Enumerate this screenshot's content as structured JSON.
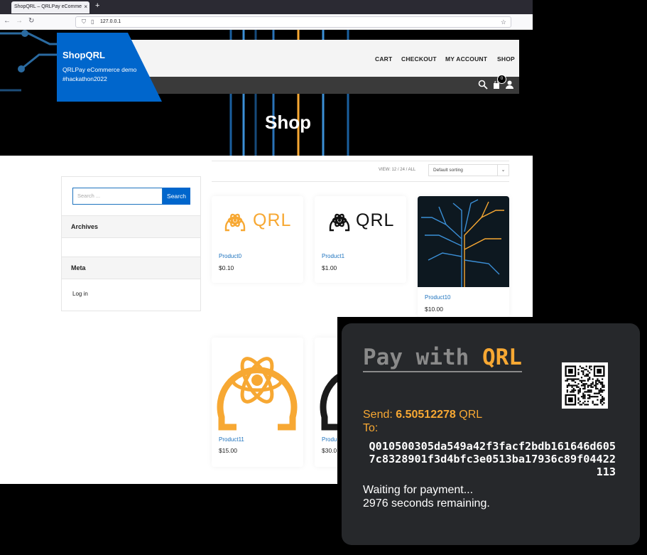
{
  "browser": {
    "tab_title": "ShopQRL – QRLPay eComme",
    "tab_close": "×",
    "new_tab": "+",
    "url": "127.0.0.1",
    "icons": [
      "back-icon",
      "forward-icon",
      "reload-icon",
      "shield-icon",
      "page-icon",
      "bookmark-star-icon"
    ]
  },
  "site": {
    "title": "ShopQRL",
    "description": "QRLPay eCommerce demo #hackathon2022",
    "nav": [
      "CART",
      "CHECKOUT",
      "MY ACCOUNT",
      "SHOP"
    ],
    "cart_count": "0",
    "brand_color": "#0066cc"
  },
  "page": {
    "heading": "Shop"
  },
  "sidebar": {
    "search_placeholder": "Search ...",
    "search_button": "Search",
    "archives_title": "Archives",
    "meta_title": "Meta",
    "login_link": "Log in"
  },
  "toolbar": {
    "view_text": "VIEW:  12 / 24 / ALL",
    "sort_selected": "Default sorting"
  },
  "products": [
    {
      "name": "Product0",
      "price": "$0.10"
    },
    {
      "name": "Product1",
      "price": "$1.00"
    },
    {
      "name": "Product10",
      "price": "$10.00"
    },
    {
      "name": "Product11",
      "price": "$15.00"
    },
    {
      "name": "Produ",
      "price": "$30.0"
    }
  ],
  "logo_text": "QRL",
  "payment": {
    "title_prefix": "Pay with ",
    "title_brand": "QRL",
    "send_label": "Send: ",
    "amount": "6.50512278",
    "currency": " QRL",
    "to_label": "To:",
    "address": "Q010500305da549a42f3facf2bdb161646d6057c8328901f3d4bfc3e0513ba17936c89f04422113",
    "status": "Waiting for payment...",
    "countdown": "2976 seconds remaining.",
    "accent_color": "#f7a833"
  }
}
